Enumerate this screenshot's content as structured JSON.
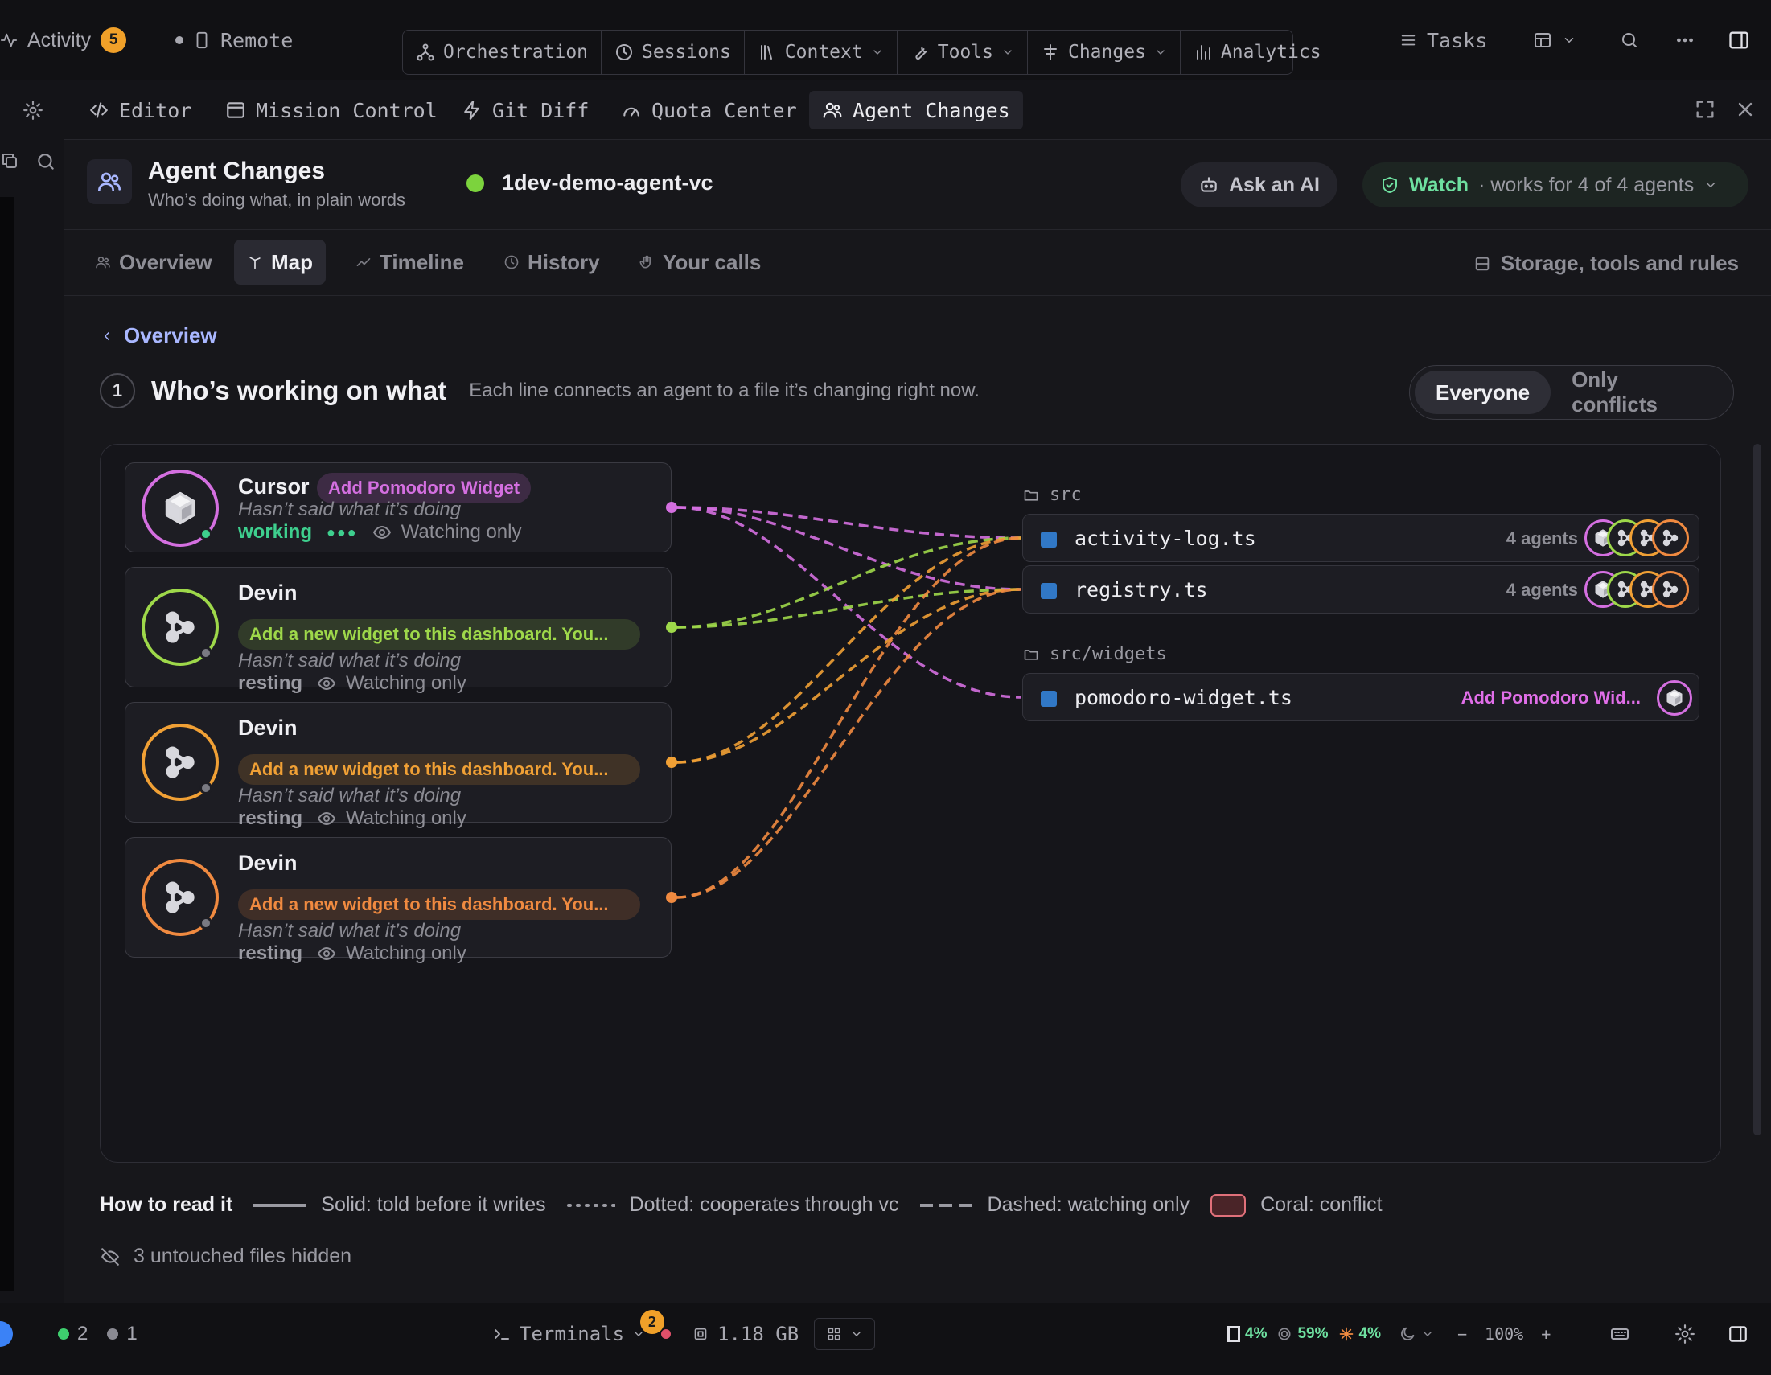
{
  "topbar": {
    "activity_label": "Activity",
    "activity_count": "5",
    "remote_label": "Remote",
    "nav": [
      {
        "label": "Orchestration",
        "icon": "graph-icon",
        "chevron": false
      },
      {
        "label": "Sessions",
        "icon": "clock-icon",
        "chevron": false
      },
      {
        "label": "Context",
        "icon": "library-icon",
        "chevron": true
      },
      {
        "label": "Tools",
        "icon": "wrench-icon",
        "chevron": true
      },
      {
        "label": "Changes",
        "icon": "git-icon",
        "chevron": true
      },
      {
        "label": "Analytics",
        "icon": "bar-chart-icon",
        "chevron": false
      }
    ],
    "tasks_label": "Tasks"
  },
  "tabs": [
    {
      "label": "Editor",
      "icon": "code-icon",
      "active": false
    },
    {
      "label": "Mission Control",
      "icon": "window-icon",
      "active": false
    },
    {
      "label": "Git Diff",
      "icon": "bolt-icon",
      "active": false
    },
    {
      "label": "Quota Center",
      "icon": "gauge-icon",
      "active": false
    },
    {
      "label": "Agent Changes",
      "icon": "users-icon",
      "active": true
    }
  ],
  "header": {
    "title": "Agent Changes",
    "subtitle": "Who’s doing what, in plain words",
    "project": "1dev-demo-agent-vc",
    "ask_label": "Ask an AI",
    "watch_label": "Watch",
    "watch_detail": "· works for 4 of 4 agents"
  },
  "subtabs": [
    {
      "label": "Overview",
      "icon": "users-icon",
      "active": false
    },
    {
      "label": "Map",
      "icon": "map-icon",
      "active": true
    },
    {
      "label": "Timeline",
      "icon": "trend-icon",
      "active": false
    },
    {
      "label": "History",
      "icon": "clock-icon",
      "active": false
    },
    {
      "label": "Your calls",
      "icon": "hand-icon",
      "active": false
    }
  ],
  "storage_label": "Storage, tools and rules",
  "back_label": "Overview",
  "section": {
    "number": "1",
    "title": "Who’s working on what",
    "description": "Each line connects an agent to a file it’s changing right now.",
    "filters": [
      {
        "label": "Everyone",
        "active": true
      },
      {
        "label": "Only conflicts",
        "active": false
      }
    ]
  },
  "agents": [
    {
      "name": "Cursor",
      "task": "Add Pomodoro Widget",
      "said": "Hasn’t said what it’s doing",
      "state": "working",
      "mode": "Watching only",
      "color": "#d46fe0",
      "icon": "cube-icon",
      "status_color": "#3ecf8e"
    },
    {
      "name": "Devin",
      "task": "Add a new widget to this dashboard. You...",
      "said": "Hasn’t said what it’s doing",
      "state": "resting",
      "mode": "Watching only",
      "color": "#9ed84a",
      "icon": "devin-icon",
      "status_color": "#7a7a82"
    },
    {
      "name": "Devin",
      "task": "Add a new widget to this dashboard. You...",
      "said": "Hasn’t said what it’s doing",
      "state": "resting",
      "mode": "Watching only",
      "color": "#f0a035",
      "icon": "devin-icon",
      "status_color": "#7a7a82"
    },
    {
      "name": "Devin",
      "task": "Add a new widget to this dashboard. You...",
      "said": "Hasn’t said what it’s doing",
      "state": "resting",
      "mode": "Watching only",
      "color": "#f08a40",
      "icon": "devin-icon",
      "status_color": "#7a7a82"
    }
  ],
  "folders": [
    {
      "name": "src",
      "files": [
        {
          "name": "activity-log.ts",
          "count": "4 agents"
        },
        {
          "name": "registry.ts",
          "count": "4 agents"
        }
      ]
    },
    {
      "name": "src/widgets",
      "files": [
        {
          "name": "pomodoro-widget.ts",
          "task": "Add Pomodoro Wid..."
        }
      ]
    }
  ],
  "legend": {
    "title": "How to read it",
    "solid": "Solid: told before it writes",
    "dotted": "Dotted: cooperates through vc",
    "dashed": "Dashed: watching only",
    "coral": "Coral: conflict"
  },
  "hidden_label": "3 untouched files hidden",
  "statusbar": {
    "green_count": "2",
    "gray_count": "1",
    "terminals_label": "Terminals",
    "terminals_count": "2",
    "memory": "1.18 GB",
    "usage_1": "4%",
    "usage_2": "59%",
    "usage_3": "4%",
    "zoom": "100%"
  }
}
